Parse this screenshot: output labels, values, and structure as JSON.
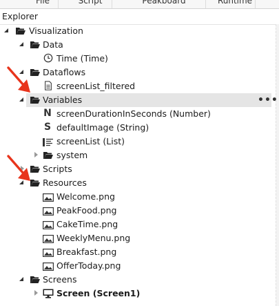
{
  "menu": {
    "tabs": [
      "File",
      "Script",
      "Peakboard",
      "Runtime"
    ]
  },
  "explorer": {
    "title": "Explorer",
    "root": "Visualization",
    "data": {
      "label": "Data",
      "items": [
        "Time (Time)"
      ]
    },
    "dataflows": {
      "label": "Dataflows",
      "items": [
        "screenList_filtered"
      ]
    },
    "variables": {
      "label": "Variables",
      "more": "•••",
      "items": [
        {
          "label": "screenDurationInSeconds (Number)",
          "type_letter": "N"
        },
        {
          "label": "defaultImage (String)",
          "type_letter": "S"
        },
        {
          "label": "screenList (List)",
          "type_icon": "list-icon"
        }
      ],
      "system": "system"
    },
    "scripts": "Scripts",
    "resources": {
      "label": "Resources",
      "items": [
        "Welcome.png",
        "PeakFood.png",
        "CakeTime.png",
        "WeeklyMenu.png",
        "Breakfast.png",
        "OfferToday.png"
      ]
    },
    "screens": {
      "label": "Screens",
      "items": [
        "Screen (Screen1)"
      ]
    }
  },
  "colors": {
    "arrow": "#e8341c",
    "selected_row": "#e5e5e5"
  }
}
